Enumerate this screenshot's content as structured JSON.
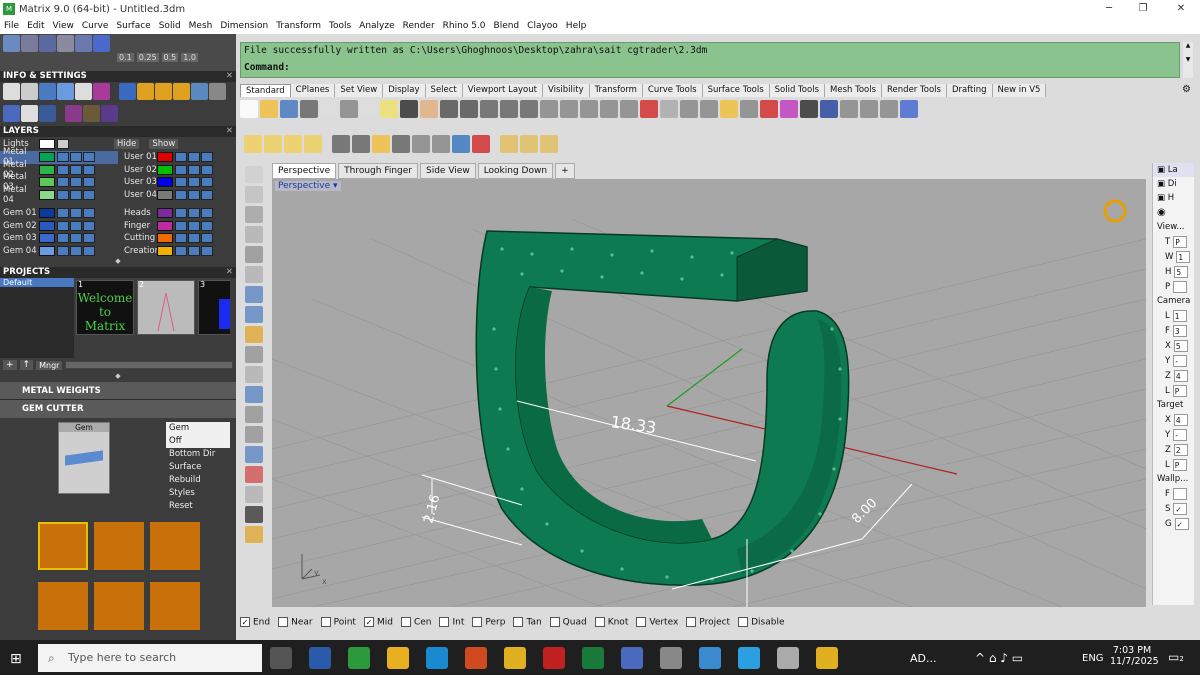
{
  "window": {
    "title": "Matrix 9.0 (64-bit) - Untitled.3dm",
    "controls": [
      "minimize",
      "maximize",
      "close"
    ]
  },
  "menu": [
    "File",
    "Edit",
    "View",
    "Curve",
    "Surface",
    "Solid",
    "Mesh",
    "Dimension",
    "Transform",
    "Tools",
    "Analyze",
    "Render",
    "Rhino 5.0",
    "Blend",
    "Clayoo",
    "Help"
  ],
  "left_panel": {
    "top_values": [
      "0.1",
      "0.25",
      "0.5",
      "1.0"
    ],
    "info_title": "INFO & SETTINGS",
    "layers_title": "LAYERS",
    "lights_label": "Lights",
    "hide_label": "Hide",
    "show_label": "Show",
    "layers_left": [
      {
        "name": "Metal 01",
        "color": "#00a651"
      },
      {
        "name": "Metal 02",
        "color": "#2db34a"
      },
      {
        "name": "Metal 03",
        "color": "#5ac85a"
      },
      {
        "name": "Metal 04",
        "color": "#8ad88a"
      },
      {
        "name": "Gem 01",
        "color": "#0a3a9a"
      },
      {
        "name": "Gem 02",
        "color": "#2a5ac0"
      },
      {
        "name": "Gem 03",
        "color": "#3a6ad0"
      },
      {
        "name": "Gem 04",
        "color": "#6a9ae0"
      }
    ],
    "layers_right": [
      {
        "name": "User 01",
        "color": "#e00000"
      },
      {
        "name": "User 02",
        "color": "#00c000"
      },
      {
        "name": "User 03",
        "color": "#0000e0"
      },
      {
        "name": "User 04",
        "color": "#7a7a7a"
      },
      {
        "name": "Heads",
        "color": "#7a2a9a"
      },
      {
        "name": "Finger",
        "color": "#c02aa0"
      },
      {
        "name": "Cutting",
        "color": "#f06a00"
      },
      {
        "name": "Creation",
        "color": "#f0b000"
      }
    ],
    "projects_title": "PROJECTS",
    "projects_selected": "Default",
    "thumbs": [
      {
        "num": "1",
        "text": "Welcome to Matrix"
      },
      {
        "num": "2",
        "text": ""
      },
      {
        "num": "3",
        "text": ""
      }
    ],
    "mngr_label": "Mngr",
    "metal_weights": "METAL WEIGHTS",
    "gem_cutter": "GEM CUTTER",
    "gem_label": "Gem",
    "gem_options": [
      "Gem",
      "Off",
      "Bottom Dir",
      "Surface",
      "Rebuild",
      "Styles",
      "Reset"
    ]
  },
  "command": {
    "line1": "File successfully written as C:\\Users\\Ghoghnoos\\Desktop\\zahra\\sait cgtrader\\2.3dm",
    "prompt": "Command:"
  },
  "toolbar_tabs": [
    "Standard",
    "CPlanes",
    "Set View",
    "Display",
    "Select",
    "Viewport Layout",
    "Visibility",
    "Transform",
    "Curve Tools",
    "Surface Tools",
    "Solid Tools",
    "Mesh Tools",
    "Render Tools",
    "Drafting",
    "New in V5"
  ],
  "view_tabs": [
    "Perspective",
    "Through Finger",
    "Side View",
    "Looking Down"
  ],
  "viewport": {
    "label": "Perspective",
    "dims": [
      {
        "value": "18.33"
      },
      {
        "value": "2.16"
      },
      {
        "value": "8.00"
      }
    ],
    "axis_labels": [
      "y",
      "x"
    ]
  },
  "snaps": [
    {
      "label": "End",
      "checked": true
    },
    {
      "label": "Near",
      "checked": false
    },
    {
      "label": "Point",
      "checked": false
    },
    {
      "label": "Mid",
      "checked": true
    },
    {
      "label": "Cen",
      "checked": false
    },
    {
      "label": "Int",
      "checked": false
    },
    {
      "label": "Perp",
      "checked": false
    },
    {
      "label": "Tan",
      "checked": false
    },
    {
      "label": "Quad",
      "checked": false
    },
    {
      "label": "Knot",
      "checked": false
    },
    {
      "label": "Vertex",
      "checked": false
    },
    {
      "label": "Project",
      "checked": false
    },
    {
      "label": "Disable",
      "checked": false
    }
  ],
  "right_panel": {
    "tabs": [
      "La",
      "Di",
      "H"
    ],
    "sections": [
      {
        "title": "View...",
        "rows": [
          {
            "k": "T",
            "v": "P"
          },
          {
            "k": "W",
            "v": "1"
          },
          {
            "k": "H",
            "v": "5"
          },
          {
            "k": "P",
            "v": ""
          }
        ]
      },
      {
        "title": "Camera",
        "rows": [
          {
            "k": "L",
            "v": "1"
          },
          {
            "k": "F",
            "v": "3"
          },
          {
            "k": "X",
            "v": "5"
          },
          {
            "k": "Y",
            "v": "-"
          },
          {
            "k": "Z",
            "v": "4"
          },
          {
            "k": "L",
            "v": "P"
          }
        ]
      },
      {
        "title": "Target",
        "rows": [
          {
            "k": "X",
            "v": "4"
          },
          {
            "k": "Y",
            "v": "-"
          },
          {
            "k": "Z",
            "v": "2"
          },
          {
            "k": "L",
            "v": "P"
          }
        ]
      },
      {
        "title": "Wallp...",
        "rows": [
          {
            "k": "F",
            "v": ""
          },
          {
            "k": "S",
            "v": "✓"
          },
          {
            "k": "G",
            "v": "✓"
          }
        ]
      }
    ]
  },
  "taskbar": {
    "search_placeholder": "Type here to search",
    "tray_text": "AD...",
    "lang": "ENG",
    "time": "7:03 PM",
    "date": "11/7/2025",
    "badge": "2"
  }
}
